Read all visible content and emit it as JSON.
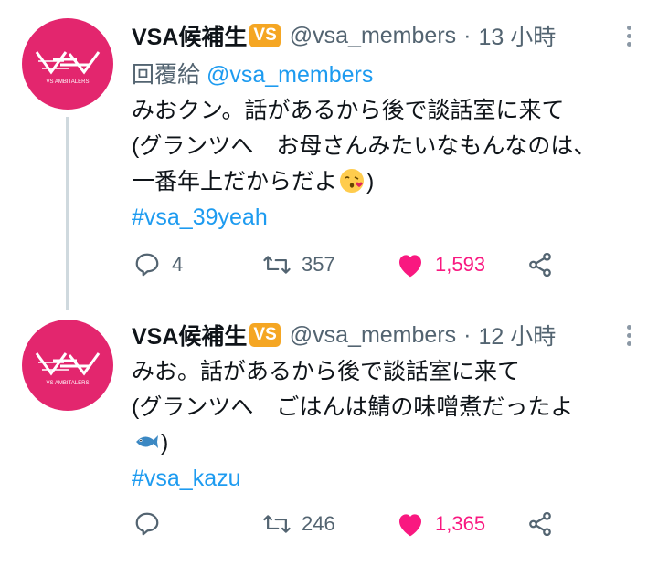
{
  "tweets": [
    {
      "author_name": "VSA候補生",
      "badge": "VS",
      "handle": "@vsa_members",
      "separator": "·",
      "time": "13 小時",
      "reply_prefix": "回覆給",
      "reply_to": "@vsa_members",
      "lines": [
        "みおクン。話があるから後で談話室に来て",
        "(グランツへ　お母さんみたいなもんなのは、",
        "一番年上だからだよ",
        ")"
      ],
      "emoji": "kissing-face-emoji",
      "hashtag": "#vsa_39yeah",
      "replies": "4",
      "retweets": "357",
      "likes": "1,593"
    },
    {
      "author_name": "VSA候補生",
      "badge": "VS",
      "handle": "@vsa_members",
      "separator": "·",
      "time": "12 小時",
      "lines": [
        "みお。話があるから後で談話室に来て",
        "(グランツへ　ごはんは鯖の味噌煮だったよ",
        ")"
      ],
      "emoji": "fish-emoji",
      "hashtag": "#vsa_kazu",
      "replies": "",
      "retweets": "246",
      "likes": "1,365"
    }
  ],
  "avatar_text": "VS AMBITALERS",
  "colors": {
    "accent": "#1d9bf0",
    "like": "#f91880",
    "avatar_bg": "#e3266e",
    "badge": "#f5a623",
    "muted": "#536471"
  }
}
